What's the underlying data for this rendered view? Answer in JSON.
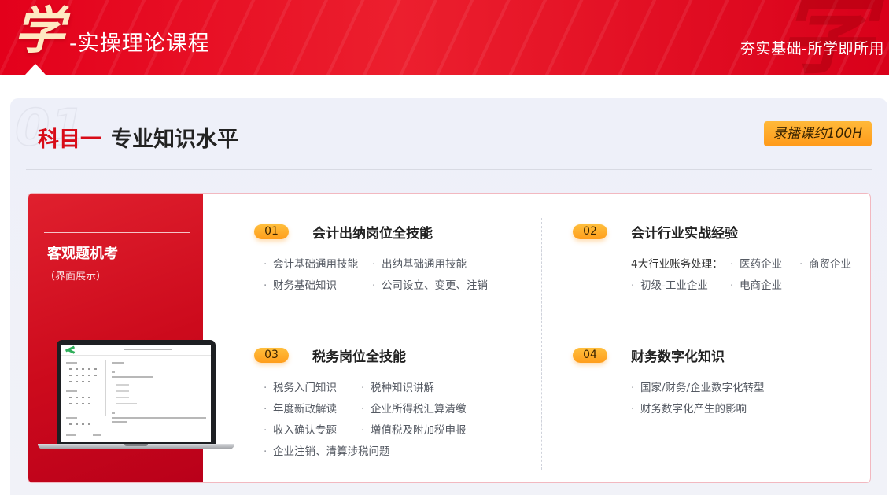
{
  "header": {
    "brand_char": "学",
    "brand_title": "-实操理论课程",
    "watermark_char": "学",
    "slogan": "夯实基础-所学即所用",
    "colors": {
      "primary": "#e3001b",
      "brand_char": "#ffe9c2"
    }
  },
  "subject": {
    "ghost_number": "01",
    "prefix": "科目一",
    "name": "专业知识水平",
    "duration_badge": "录播课约100H",
    "colors": {
      "prefix": "#d80c18",
      "badge": "#ffb03a"
    }
  },
  "side_panel": {
    "title": "客观题机考",
    "subtitle": "（界面展示）",
    "illustration": "laptop-exam-interface"
  },
  "modules": [
    {
      "number": "01",
      "title": "会计出纳岗位全技能",
      "items": [
        "会计基础通用技能",
        "出纳基础通用技能",
        "财务基础知识",
        "公司设立、变更、注销"
      ]
    },
    {
      "number": "02",
      "title": "会计行业实战经验",
      "lead": "4大行业账务处理：",
      "items": [
        "医药企业",
        "商贸企业",
        "初级-工业企业",
        "电商企业"
      ]
    },
    {
      "number": "03",
      "title": "税务岗位全技能",
      "items": [
        "税务入门知识",
        "税种知识讲解",
        "年度新政解读",
        "企业所得税汇算清缴",
        "收入确认专题",
        "增值税及附加税申报",
        "企业注销、清算涉税问题"
      ]
    },
    {
      "number": "04",
      "title": "财务数字化知识",
      "items": [
        "国家/财务/企业数字化转型",
        "财务数字化产生的影响"
      ]
    }
  ]
}
